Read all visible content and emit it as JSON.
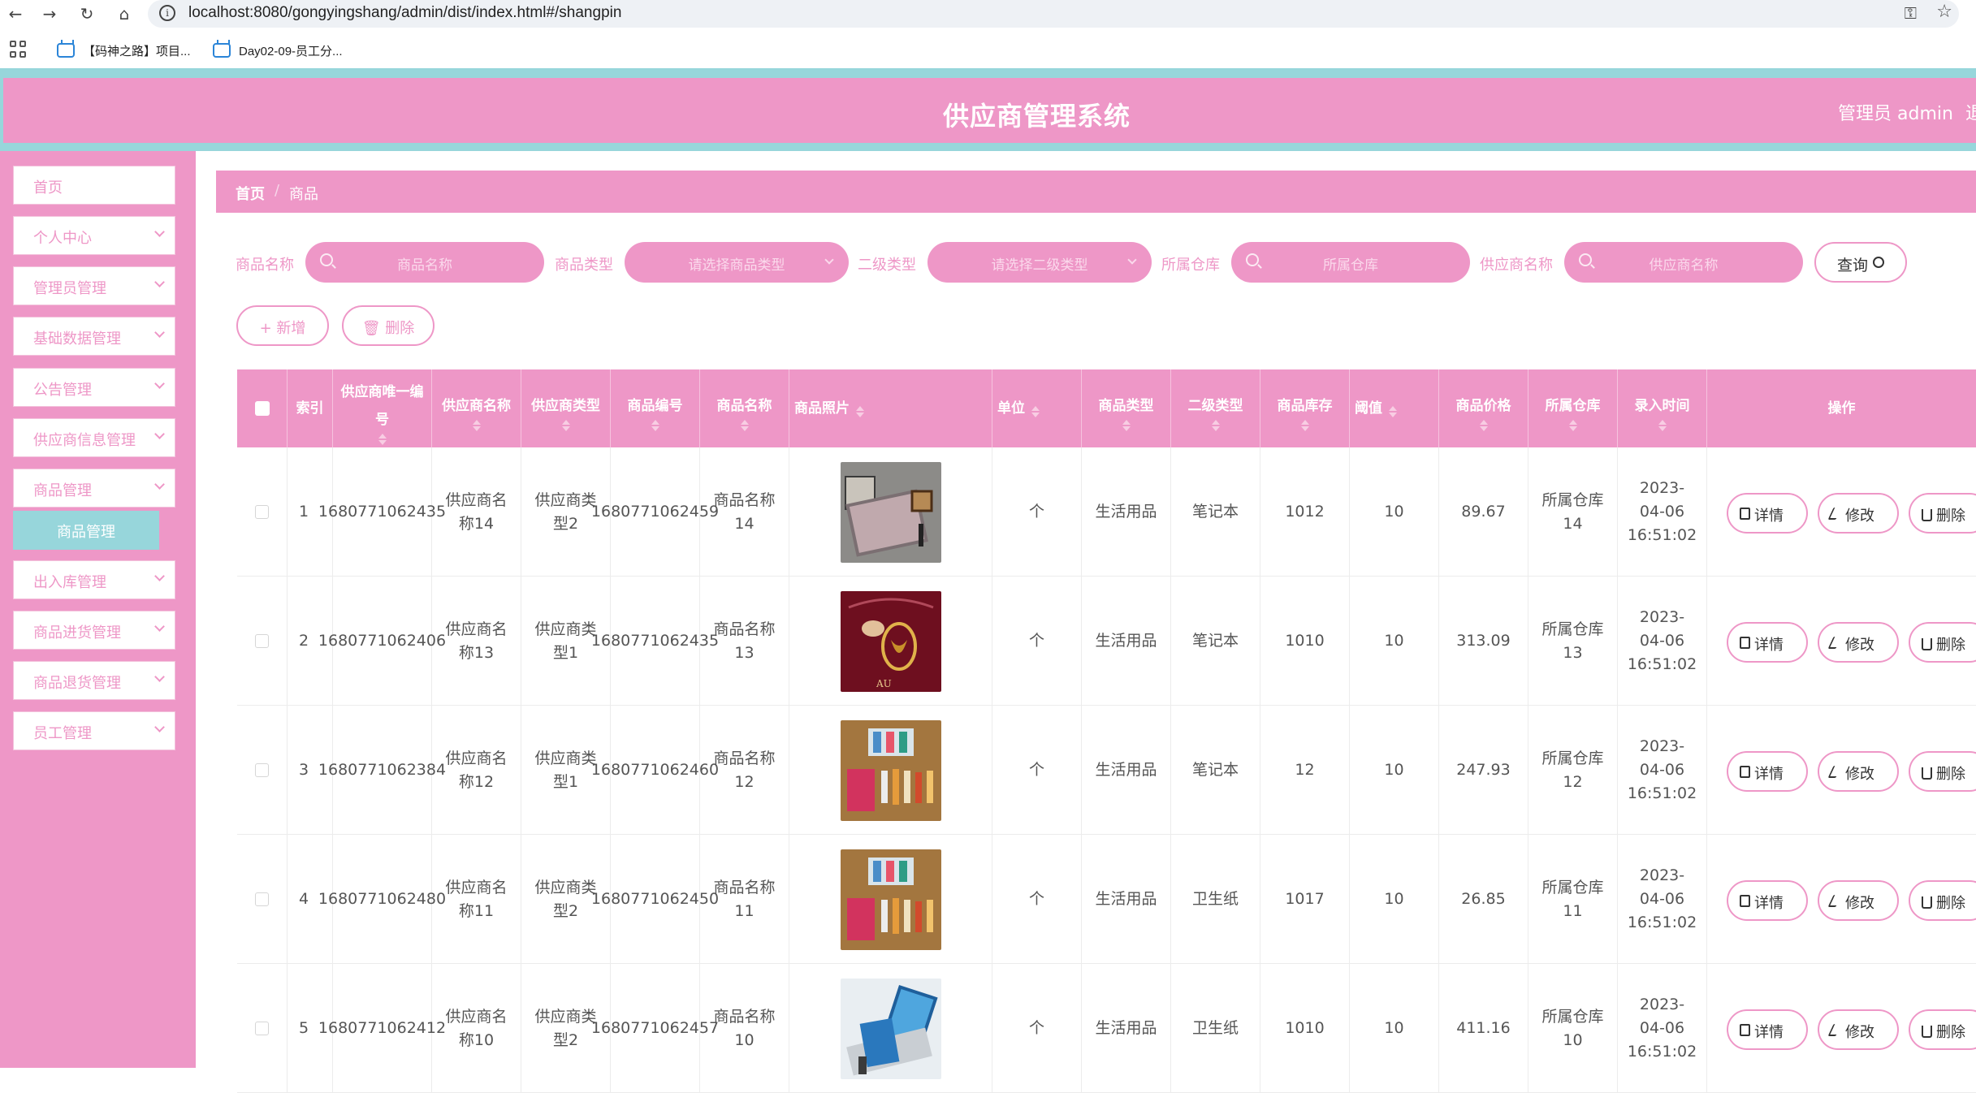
{
  "browser": {
    "url": "localhost:8080/gongyingshang/admin/dist/index.html#/shangpin",
    "bookmarks": [
      "【码神之路】项目...",
      "Day02-09-员工分..."
    ]
  },
  "header": {
    "title": "供应商管理系统",
    "user": "管理员 admin",
    "logout": "退"
  },
  "sidebar": {
    "items": [
      {
        "label": "首页",
        "has_arrow": false
      },
      {
        "label": "个人中心",
        "has_arrow": true
      },
      {
        "label": "管理员管理",
        "has_arrow": true
      },
      {
        "label": "基础数据管理",
        "has_arrow": true
      },
      {
        "label": "公告管理",
        "has_arrow": true
      },
      {
        "label": "供应商信息管理",
        "has_arrow": true
      },
      {
        "label": "商品管理",
        "has_arrow": true
      },
      {
        "label": "出入库管理",
        "has_arrow": true
      },
      {
        "label": "商品进货管理",
        "has_arrow": true
      },
      {
        "label": "商品退货管理",
        "has_arrow": true
      },
      {
        "label": "员工管理",
        "has_arrow": true
      }
    ],
    "active_sub": "商品管理"
  },
  "breadcrumb": {
    "home": "首页",
    "sep": "/",
    "current": "商品"
  },
  "search": {
    "fields": [
      {
        "label": "商品名称",
        "placeholder": "商品名称"
      },
      {
        "label": "商品类型",
        "placeholder": "请选择商品类型"
      },
      {
        "label": "二级类型",
        "placeholder": "请选择二级类型"
      },
      {
        "label": "所属仓库",
        "placeholder": "所属仓库"
      },
      {
        "label": "供应商名称",
        "placeholder": "供应商名称"
      }
    ],
    "query_label": "查询"
  },
  "actions": {
    "add": "+ 新增",
    "delete": "删除"
  },
  "table": {
    "headers": {
      "index": "索引",
      "supplier_id": "供应商唯一编号",
      "supplier_name": "供应商名称",
      "supplier_type": "供应商类型",
      "goods_no": "商品编号",
      "goods_name": "商品名称",
      "photo": "商品照片",
      "unit": "单位",
      "goods_type": "商品类型",
      "sub_type": "二级类型",
      "stock": "商品库存",
      "threshold": "阈值",
      "price": "商品价格",
      "warehouse": "所属仓库",
      "time": "录入时间",
      "ops": "操作"
    },
    "op_labels": {
      "detail": "详情",
      "edit": "修改",
      "delete": "删除"
    },
    "rows": [
      {
        "index": "1",
        "supplier_id": "1680771062435",
        "supplier_name": "供应商名称14",
        "supplier_type": "供应商类型2",
        "goods_no": "1680771062459",
        "goods_name": "商品名称14",
        "unit": "个",
        "goods_type": "生活用品",
        "sub_type": "笔记本",
        "stock": "1012",
        "threshold": "10",
        "price": "89.67",
        "warehouse": "所属仓库14",
        "time": "2023-04-06 16:51:02"
      },
      {
        "index": "2",
        "supplier_id": "1680771062406",
        "supplier_name": "供应商名称13",
        "supplier_type": "供应商类型1",
        "goods_no": "1680771062435",
        "goods_name": "商品名称13",
        "unit": "个",
        "goods_type": "生活用品",
        "sub_type": "笔记本",
        "stock": "1010",
        "threshold": "10",
        "price": "313.09",
        "warehouse": "所属仓库13",
        "time": "2023-04-06 16:51:02"
      },
      {
        "index": "3",
        "supplier_id": "1680771062384",
        "supplier_name": "供应商名称12",
        "supplier_type": "供应商类型1",
        "goods_no": "1680771062460",
        "goods_name": "商品名称12",
        "unit": "个",
        "goods_type": "生活用品",
        "sub_type": "笔记本",
        "stock": "12",
        "threshold": "10",
        "price": "247.93",
        "warehouse": "所属仓库12",
        "time": "2023-04-06 16:51:02"
      },
      {
        "index": "4",
        "supplier_id": "1680771062480",
        "supplier_name": "供应商名称11",
        "supplier_type": "供应商类型2",
        "goods_no": "1680771062450",
        "goods_name": "商品名称11",
        "unit": "个",
        "goods_type": "生活用品",
        "sub_type": "卫生纸",
        "stock": "1017",
        "threshold": "10",
        "price": "26.85",
        "warehouse": "所属仓库11",
        "time": "2023-04-06 16:51:02"
      },
      {
        "index": "5",
        "supplier_id": "1680771062412",
        "supplier_name": "供应商名称10",
        "supplier_type": "供应商类型2",
        "goods_no": "1680771062457",
        "goods_name": "商品名称10",
        "unit": "个",
        "goods_type": "生活用品",
        "sub_type": "卫生纸",
        "stock": "1010",
        "threshold": "10",
        "price": "411.16",
        "warehouse": "所属仓库10",
        "time": "2023-04-06 16:51:02"
      }
    ]
  },
  "colors": {
    "primary": "#ee97c7",
    "accent": "#97d6db"
  }
}
